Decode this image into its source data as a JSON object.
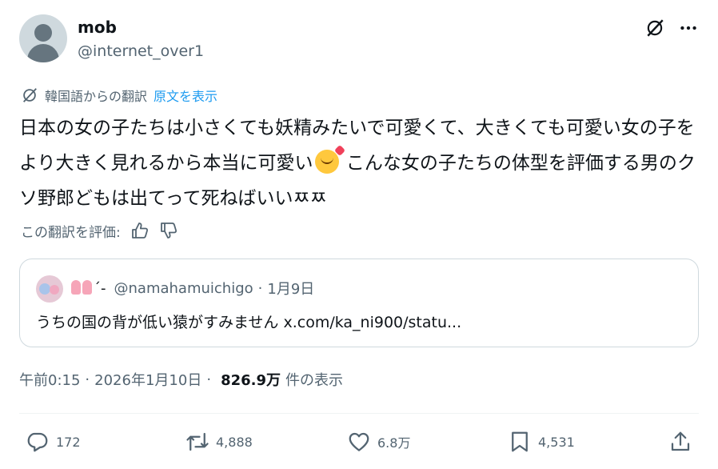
{
  "author": {
    "display_name": "mob",
    "handle": "@internet_over1"
  },
  "header_icons": [
    "grok-icon",
    "more-icon"
  ],
  "translation": {
    "label": "韓国語からの翻訳",
    "show_original_link": "原文を表示"
  },
  "tweet": {
    "text_part1": "日本の女の子たちは小さくても妖精みたいで可愛くて、大きくても可愛い女の子をより大きく見れるから本当に可愛い",
    "emoji": "smiling-face-with-hearts",
    "text_part2": " こんな女の子たちの体型を評価する男のクソ野郎どもは出てって死ねばいいㅉㅉ"
  },
  "rate_translation": {
    "label": "この翻訳を評価:"
  },
  "quote": {
    "decoration": "´-",
    "handle": "@namahamuichigo",
    "separator": "·",
    "date": "1月9日",
    "text": "うちの国の背が低い猿がすみません x.com/ka_ni900/statu..."
  },
  "meta": {
    "time": "午前0:15",
    "separator1": "·",
    "date": "2026年1月10日",
    "separator2": "·",
    "views_count": "826.9万",
    "views_label": "件の表示"
  },
  "actions": {
    "reply_count": "172",
    "repost_count": "4,888",
    "like_count": "6.8万",
    "bookmark_count": "4,531"
  }
}
